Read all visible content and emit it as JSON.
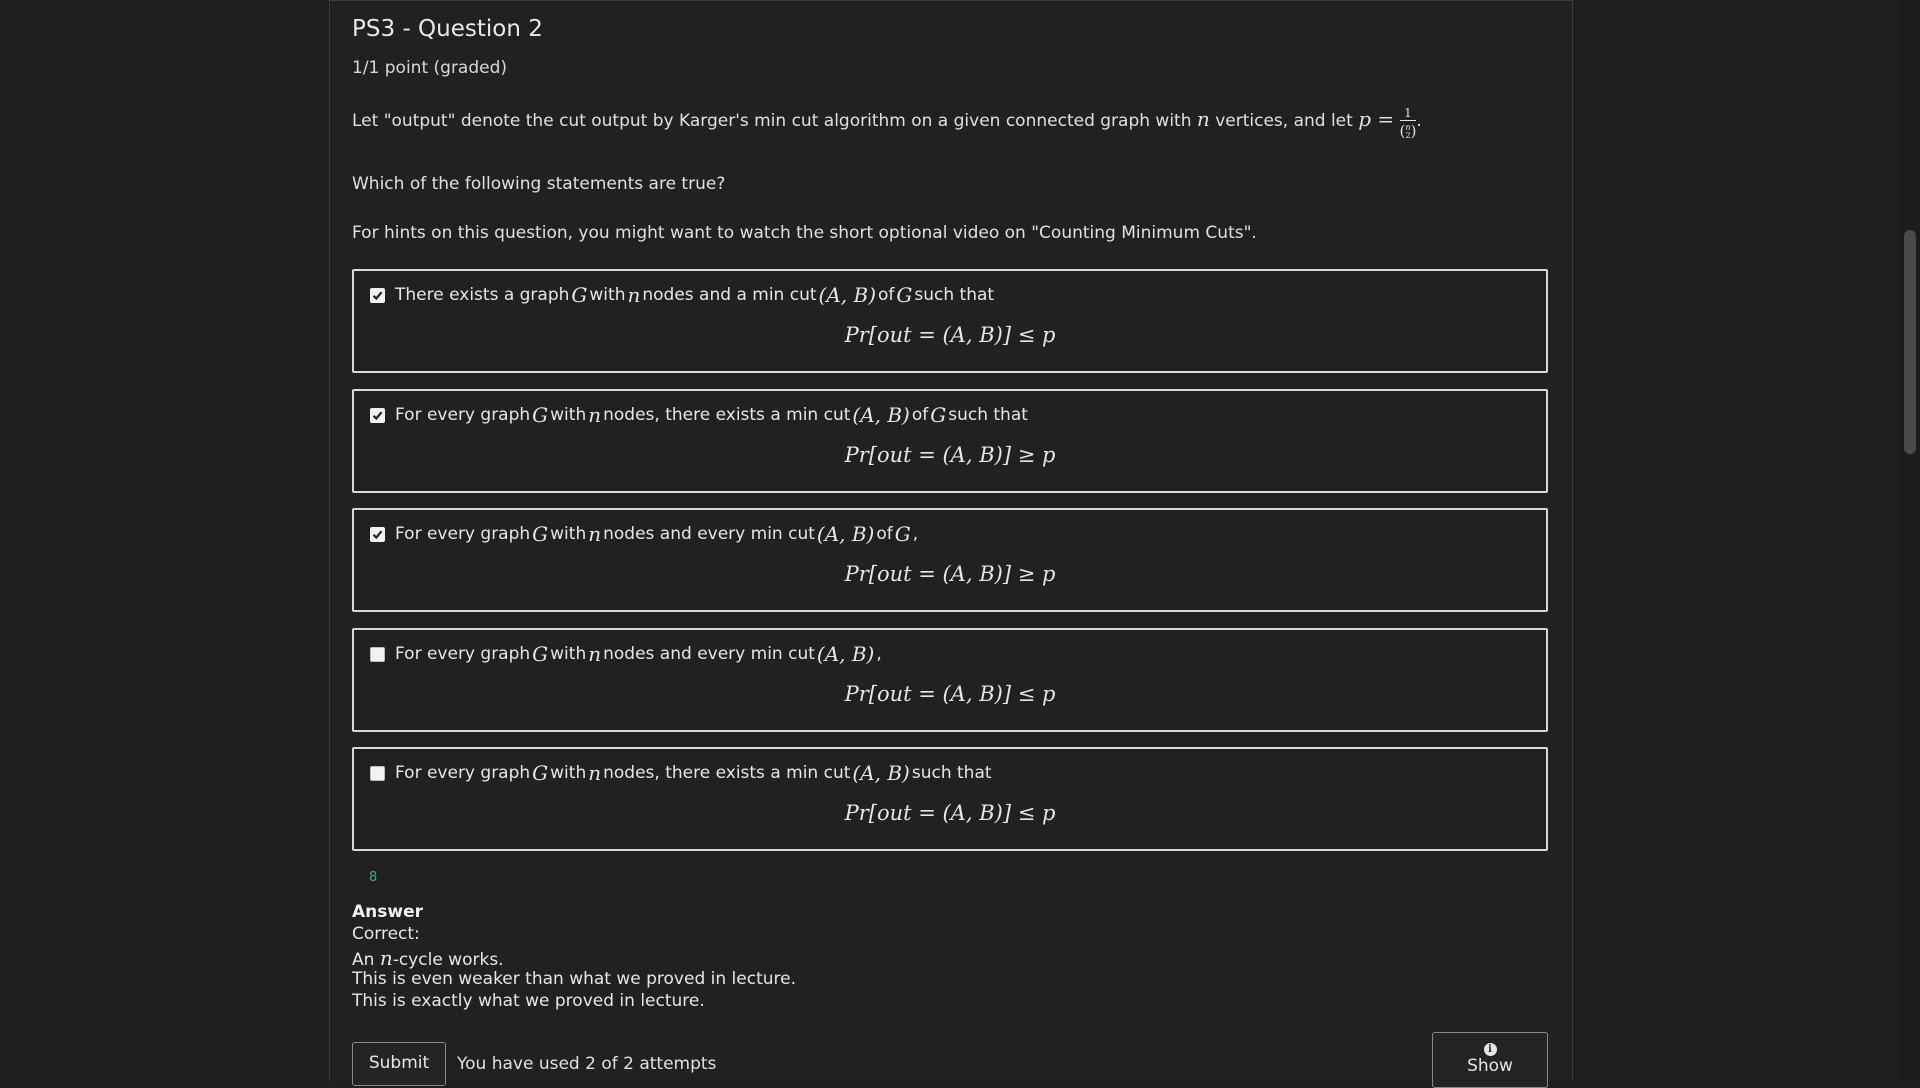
{
  "problem": {
    "title": "PS3 - Question 2",
    "points": "1/1 point (graded)",
    "intro_before_n": "Let \"output\" denote the cut output by Karger's min cut algorithm on a given connected graph with ",
    "intro_after_n": " vertices, and let ",
    "p_equals": "p =",
    "frac_num": "1",
    "intro_end": ".",
    "question": "Which of the following statements are true?",
    "hint": "For hints on this question, you might want to watch the short optional video on \"Counting Minimum Cuts\"."
  },
  "options": [
    {
      "checked": true,
      "parts": [
        "There exists a graph ",
        "G",
        " with ",
        "n",
        " nodes and a min cut ",
        "(A, B)",
        " of ",
        "G",
        " such that"
      ],
      "formula": "Pr[out = (A, B)] ≤ p"
    },
    {
      "checked": true,
      "parts": [
        "For every graph ",
        "G",
        " with ",
        "n",
        " nodes, there exists a min cut ",
        "(A, B)",
        " of ",
        "G",
        " such that"
      ],
      "formula": "Pr[out = (A, B)] ≥ p"
    },
    {
      "checked": true,
      "parts": [
        "For every graph ",
        "G",
        " with ",
        "n",
        " nodes and every min cut ",
        "(A, B)",
        " of ",
        "G",
        ","
      ],
      "formula": "Pr[out = (A, B)] ≥ p"
    },
    {
      "checked": false,
      "parts": [
        "For every graph ",
        "G",
        " with ",
        "n",
        " nodes and every min cut ",
        "(A, B)",
        ","
      ],
      "formula": "Pr[out = (A, B)] ≤ p"
    },
    {
      "checked": false,
      "parts": [
        "For every graph ",
        "G",
        " with ",
        "n",
        " nodes, there exists a min cut ",
        "(A, B)",
        " such that"
      ],
      "formula": "Pr[out = (A, B)] ≤ p"
    }
  ],
  "status_number": "8",
  "answer": {
    "heading": "Answer",
    "line1": "Correct:",
    "line2_a": "An ",
    "line2_n": "n",
    "line2_b": "-cycle works.",
    "line3": "This is even weaker than what we proved in lecture.",
    "line4": "This is exactly what we proved in lecture."
  },
  "controls": {
    "submit_label": "Submit",
    "attempts": "You have used 2 of 2 attempts",
    "show_label": "Show",
    "show_icon": "info-icon"
  }
}
